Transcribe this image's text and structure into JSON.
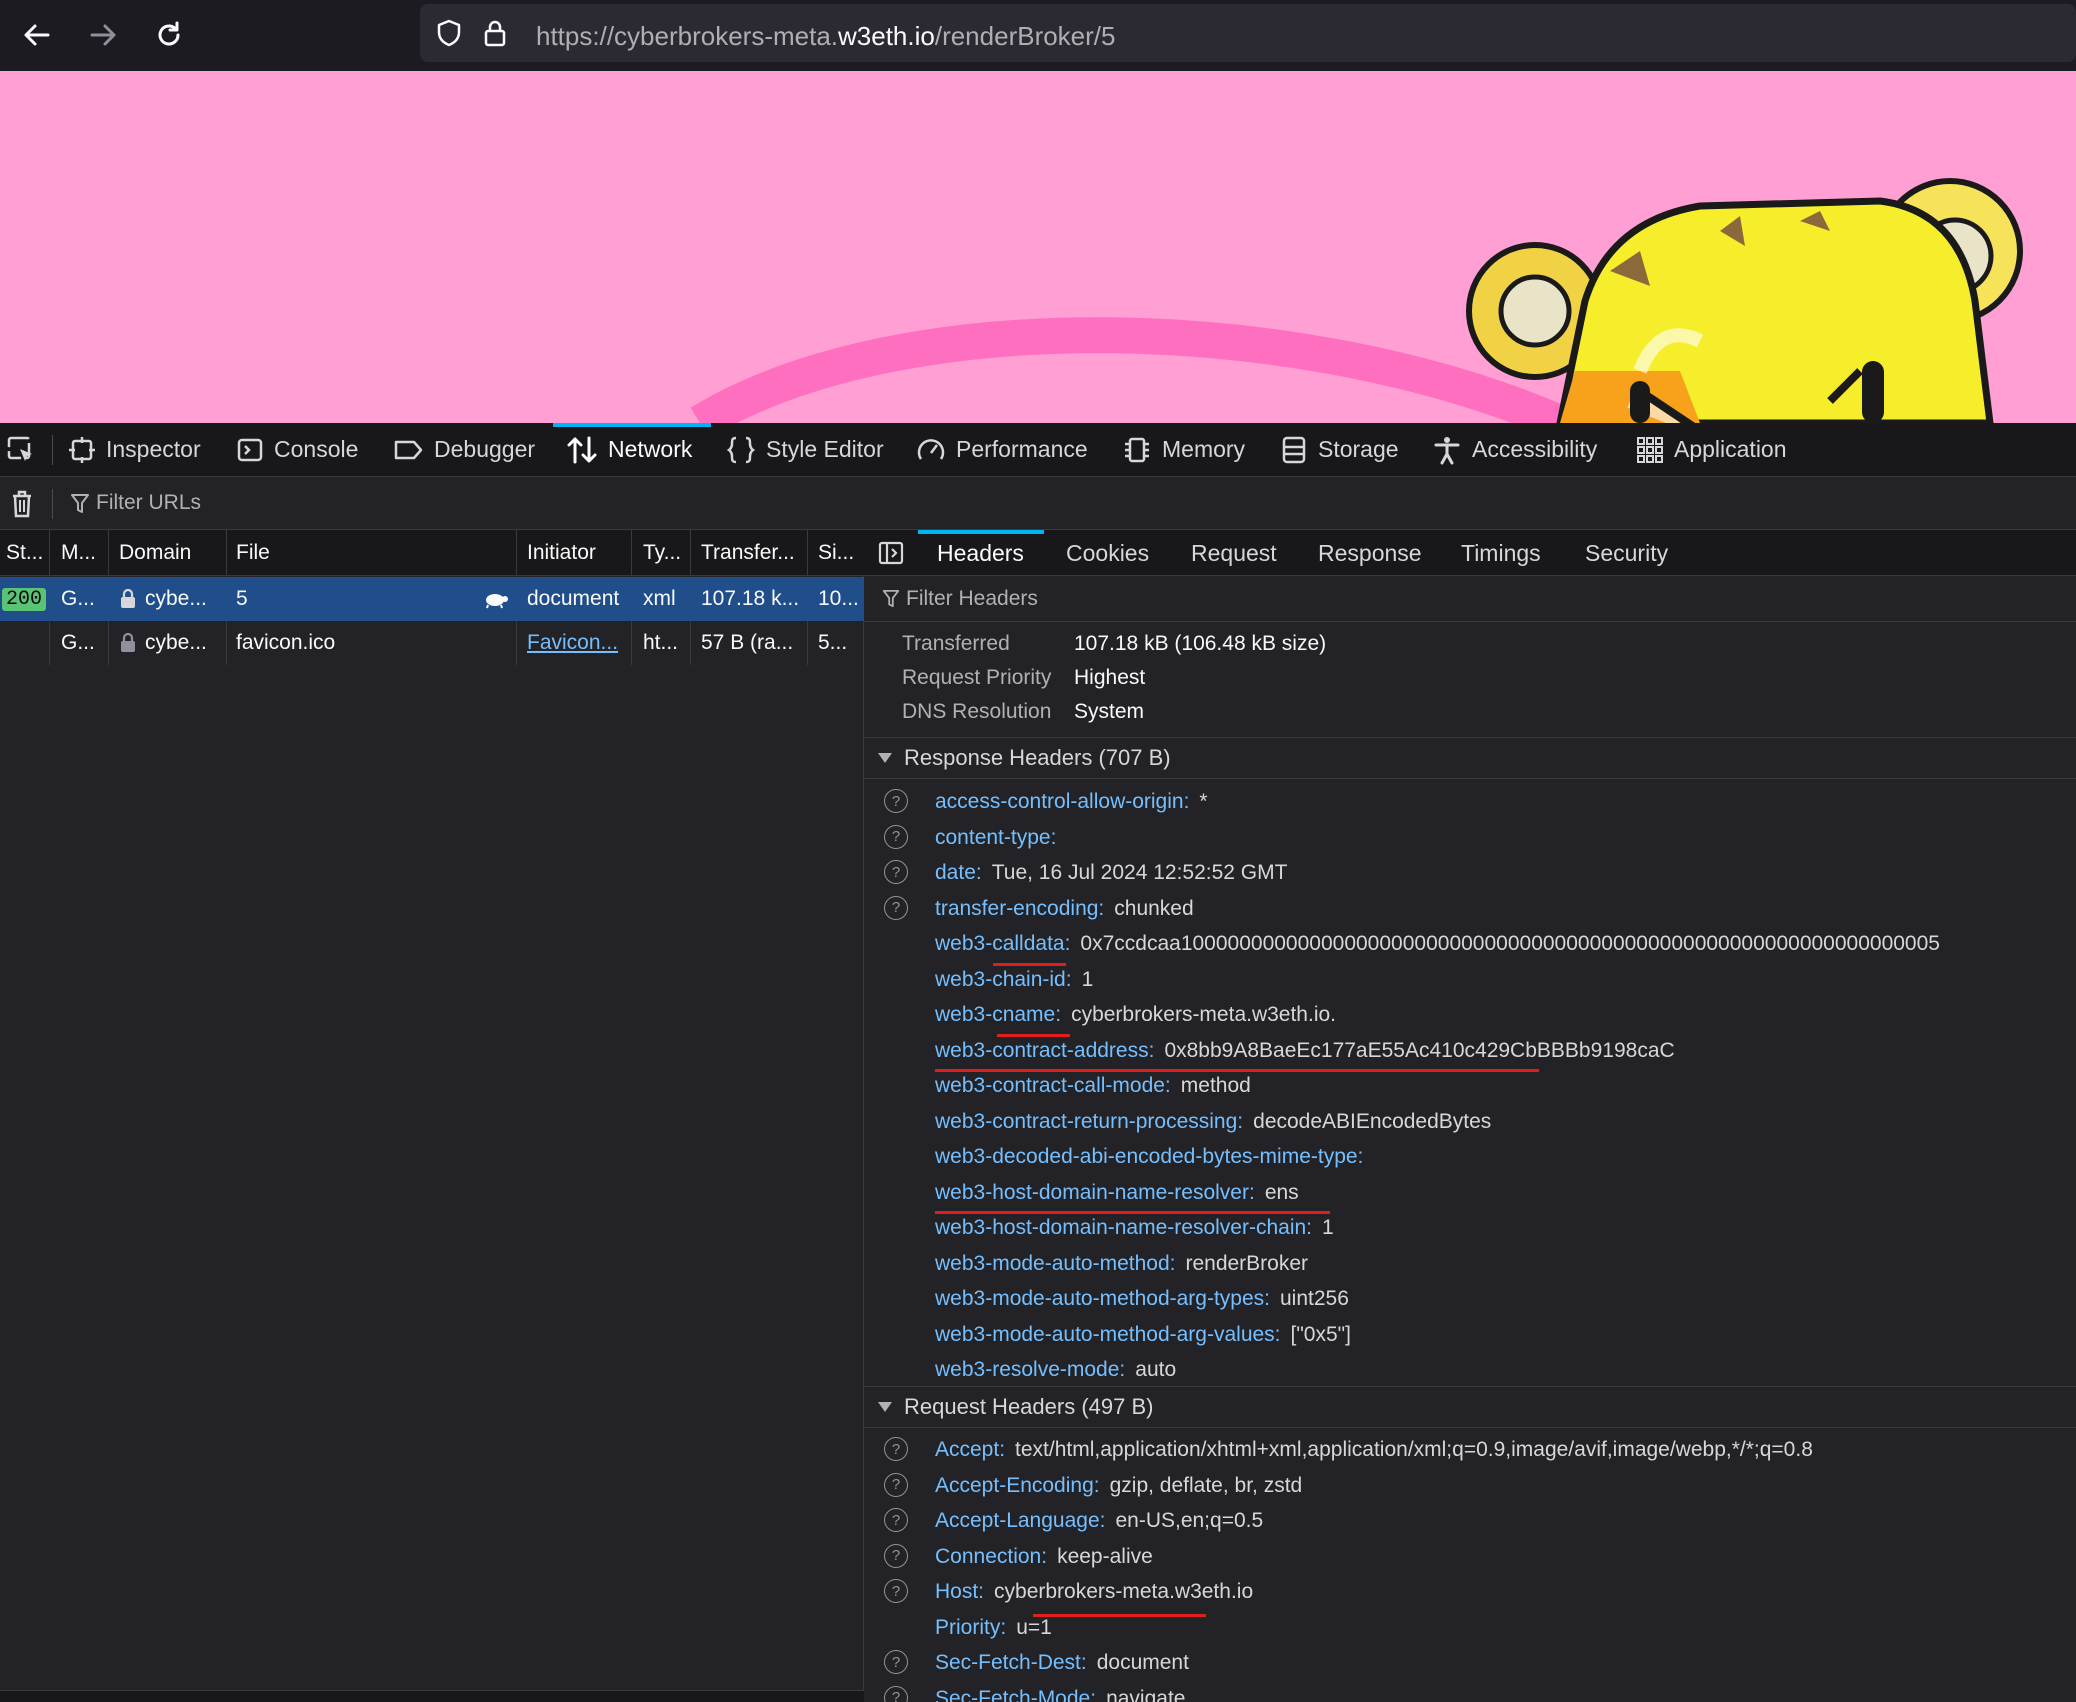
{
  "browser": {
    "url_prefix": "https://cyberbrokers-meta.",
    "url_domain": "w3eth.io",
    "url_suffix": "/renderBroker/5"
  },
  "devtools": {
    "tools": [
      "Inspector",
      "Console",
      "Debugger",
      "Network",
      "Style Editor",
      "Performance",
      "Memory",
      "Storage",
      "Accessibility",
      "Application"
    ],
    "selected_tool": "Network",
    "filter_placeholder": "Filter URLs",
    "columns": [
      "St...",
      "M...",
      "Domain",
      "File",
      "Initiator",
      "Ty...",
      "Transfer...",
      "Si..."
    ],
    "requests": [
      {
        "status": "200",
        "method": "G...",
        "domain": "cybe...",
        "file": "5",
        "initiator": "document",
        "type": "xml",
        "transferred": "107.18 k...",
        "size": "10..."
      },
      {
        "status": "",
        "method": "G...",
        "domain": "cybe...",
        "file": "favicon.ico",
        "initiator": "Favicon...",
        "type": "ht...",
        "transferred": "57 B (ra...",
        "size": "5..."
      }
    ],
    "detail_tabs": [
      "Headers",
      "Cookies",
      "Request",
      "Response",
      "Timings",
      "Security"
    ],
    "selected_detail_tab": "Headers",
    "filter_headers_placeholder": "Filter Headers",
    "summary": [
      {
        "label": "Transferred",
        "value": "107.18 kB (106.48 kB size)"
      },
      {
        "label": "Request Priority",
        "value": "Highest"
      },
      {
        "label": "DNS Resolution",
        "value": "System"
      }
    ],
    "response_headers_title": "Response Headers (707 B)",
    "response_headers": [
      {
        "name": "access-control-allow-origin:",
        "value": "*",
        "help": true
      },
      {
        "name": "content-type:",
        "value": "",
        "help": true
      },
      {
        "name": "date:",
        "value": "Tue, 16 Jul 2024 12:52:52 GMT",
        "help": true
      },
      {
        "name": "transfer-encoding:",
        "value": "chunked",
        "help": true
      },
      {
        "name": "web3-calldata:",
        "value": "0x7ccdcaa10000000000000000000000000000000000000000000000000000000000000005",
        "help": false
      },
      {
        "name": "web3-chain-id:",
        "value": "1",
        "help": false
      },
      {
        "name": "web3-cname:",
        "value": "cyberbrokers-meta.w3eth.io.",
        "help": false
      },
      {
        "name": "web3-contract-address:",
        "value": "0x8bb9A8BaeEc177aE55Ac410c429CbBBBb9198caC",
        "help": false
      },
      {
        "name": "web3-contract-call-mode:",
        "value": "method",
        "help": false
      },
      {
        "name": "web3-contract-return-processing:",
        "value": "decodeABIEncodedBytes",
        "help": false
      },
      {
        "name": "web3-decoded-abi-encoded-bytes-mime-type:",
        "value": "",
        "help": false
      },
      {
        "name": "web3-host-domain-name-resolver:",
        "value": "ens",
        "help": false
      },
      {
        "name": "web3-host-domain-name-resolver-chain:",
        "value": "1",
        "help": false
      },
      {
        "name": "web3-mode-auto-method:",
        "value": "renderBroker",
        "help": false
      },
      {
        "name": "web3-mode-auto-method-arg-types:",
        "value": "uint256",
        "help": false
      },
      {
        "name": "web3-mode-auto-method-arg-values:",
        "value": "[\"0x5\"]",
        "help": false
      },
      {
        "name": "web3-resolve-mode:",
        "value": "auto",
        "help": false
      }
    ],
    "request_headers_title": "Request Headers (497 B)",
    "request_headers": [
      {
        "name": "Accept:",
        "value": "text/html,application/xhtml+xml,application/xml;q=0.9,image/avif,image/webp,*/*;q=0.8",
        "help": true
      },
      {
        "name": "Accept-Encoding:",
        "value": "gzip, deflate, br, zstd",
        "help": true
      },
      {
        "name": "Accept-Language:",
        "value": "en-US,en;q=0.5",
        "help": true
      },
      {
        "name": "Connection:",
        "value": "keep-alive",
        "help": true
      },
      {
        "name": "Host:",
        "value": "cyberbrokers-meta.w3eth.io",
        "help": true
      },
      {
        "name": "Priority:",
        "value": "u=1",
        "help": false
      },
      {
        "name": "Sec-Fetch-Dest:",
        "value": "document",
        "help": true
      },
      {
        "name": "Sec-Fetch-Mode:",
        "value": "navigate",
        "help": true
      }
    ]
  },
  "colors": {
    "accent": "#00b3f4",
    "header_name": "#75bfff",
    "selected_row": "#204e8a",
    "annotation": "#e11d1d"
  }
}
